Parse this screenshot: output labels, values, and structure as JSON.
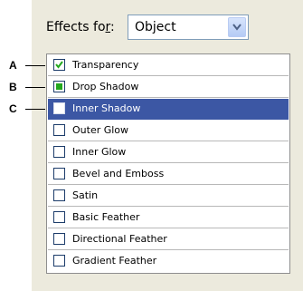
{
  "header": {
    "label_pre": "Effects fo",
    "label_ul": "r",
    "label_post": ":",
    "select_value": "Object"
  },
  "effects": [
    {
      "label": "Transparency",
      "state": "checked",
      "selected": false
    },
    {
      "label": "Drop Shadow",
      "state": "filled",
      "selected": false
    },
    {
      "label": "Inner Shadow",
      "state": "empty",
      "selected": true
    },
    {
      "label": "Outer Glow",
      "state": "empty",
      "selected": false
    },
    {
      "label": "Inner Glow",
      "state": "empty",
      "selected": false
    },
    {
      "label": "Bevel and Emboss",
      "state": "empty",
      "selected": false
    },
    {
      "label": "Satin",
      "state": "empty",
      "selected": false
    },
    {
      "label": "Basic Feather",
      "state": "empty",
      "selected": false
    },
    {
      "label": "Directional Feather",
      "state": "empty",
      "selected": false
    },
    {
      "label": "Gradient Feather",
      "state": "empty",
      "selected": false
    }
  ],
  "callouts": [
    "A",
    "B",
    "C"
  ],
  "colors": {
    "selection": "#3c57a4",
    "panel": "#eceadd",
    "check": "#23a81e"
  }
}
